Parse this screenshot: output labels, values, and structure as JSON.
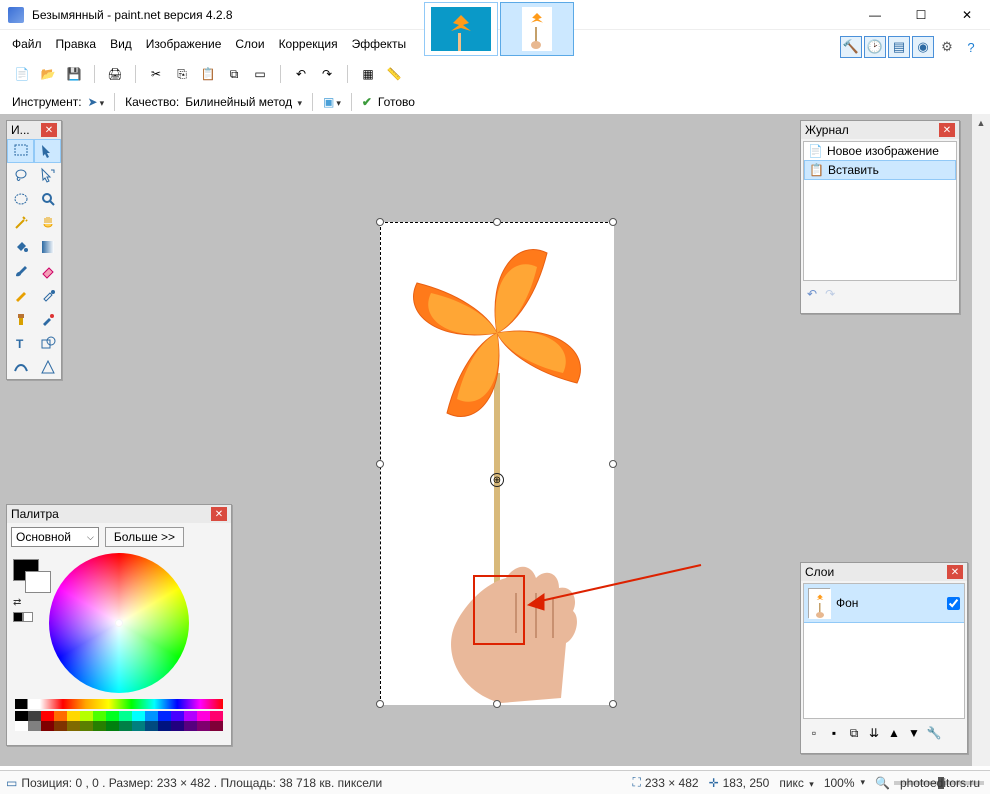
{
  "title": "Безымянный - paint.net версия 4.2.8",
  "menu": [
    "Файл",
    "Правка",
    "Вид",
    "Изображение",
    "Слои",
    "Коррекция",
    "Эффекты"
  ],
  "toolbar2": {
    "tool_label": "Инструмент:",
    "quality_label": "Качество:",
    "quality_value": "Билинейный метод",
    "ready": "Готово"
  },
  "tools_panel": {
    "title": "И..."
  },
  "history": {
    "title": "Журнал",
    "items": [
      "Новое изображение",
      "Вставить"
    ]
  },
  "layers": {
    "title": "Слои",
    "layer_name": "Фон"
  },
  "palette": {
    "title": "Палитра",
    "mode": "Основной",
    "more": "Больше >>"
  },
  "status": {
    "pos_label": "Позиция: 0 , 0 . Размер: 233  × 482 . Площадь: 38 718 кв. пиксели",
    "canvas_size": "233 × 482",
    "cursor": "183, 250",
    "units": "пикс",
    "zoom": "100%"
  },
  "credit": "photoeditors.ru",
  "icons": {
    "window_min": "—",
    "window_max": "☐",
    "window_close": "✕"
  }
}
